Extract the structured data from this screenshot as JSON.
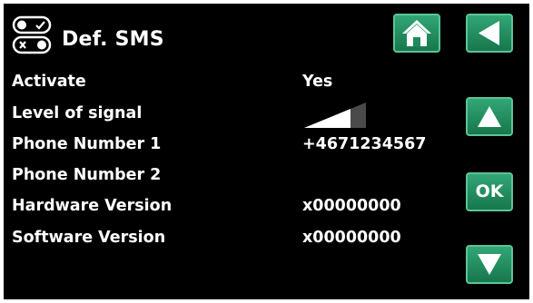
{
  "header": {
    "title": "Def. SMS",
    "icon": "sms-settings-icon"
  },
  "rows": [
    {
      "label": "Activate",
      "value": "Yes"
    },
    {
      "label": "Level of signal",
      "signal_level": 0.75
    },
    {
      "label": "Phone Number 1",
      "value": "+4671234567"
    },
    {
      "label": "Phone Number 2",
      "value": ""
    },
    {
      "label": "Hardware Version",
      "value": "x00000000"
    },
    {
      "label": "Software Version",
      "value": "x00000000"
    }
  ],
  "buttons": {
    "home_icon": "home-icon",
    "back_icon": "back-arrow-icon",
    "up_icon": "up-arrow-icon",
    "ok_label": "OK",
    "down_icon": "down-arrow-icon"
  },
  "colors": {
    "background": "#000000",
    "text": "#ffffff",
    "button": "#1f8a5c",
    "signal_filled": "#ffffff",
    "signal_empty": "#4a4a4a"
  }
}
